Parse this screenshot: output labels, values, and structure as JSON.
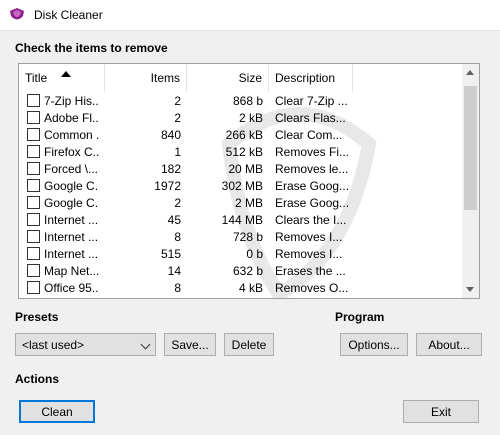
{
  "window": {
    "title": "Disk Cleaner"
  },
  "list_section": {
    "label": "Check the items to remove"
  },
  "columns": {
    "title": "Title",
    "items": "Items",
    "size": "Size",
    "description": "Description"
  },
  "rows": [
    {
      "title": "7-Zip His...",
      "items": "2",
      "size": "868 b",
      "description": "Clear 7-Zip ..."
    },
    {
      "title": "Adobe Fl...",
      "items": "2",
      "size": "2 kB",
      "description": "Clears Flas..."
    },
    {
      "title": "Common ...",
      "items": "840",
      "size": "266 kB",
      "description": "Clear Com..."
    },
    {
      "title": "Firefox C...",
      "items": "1",
      "size": "512 kB",
      "description": "Removes Fi..."
    },
    {
      "title": "Forced \\...",
      "items": "182",
      "size": "20 MB",
      "description": "Removes le..."
    },
    {
      "title": "Google C...",
      "items": "1972",
      "size": "302 MB",
      "description": "Erase Goog..."
    },
    {
      "title": "Google C...",
      "items": "2",
      "size": "2 MB",
      "description": "Erase Goog..."
    },
    {
      "title": "Internet ...",
      "items": "45",
      "size": "144 MB",
      "description": "Clears the I..."
    },
    {
      "title": "Internet ...",
      "items": "8",
      "size": "728 b",
      "description": "Removes I..."
    },
    {
      "title": "Internet ...",
      "items": "515",
      "size": "0 b",
      "description": "Removes I..."
    },
    {
      "title": "Map Net...",
      "items": "14",
      "size": "632 b",
      "description": "Erases the ..."
    },
    {
      "title": "Office 95...",
      "items": "8",
      "size": "4 kB",
      "description": "Removes O..."
    }
  ],
  "presets": {
    "label": "Presets",
    "selected": "<last used>",
    "save_label": "Save...",
    "delete_label": "Delete"
  },
  "program": {
    "label": "Program",
    "options_label": "Options...",
    "about_label": "About..."
  },
  "actions": {
    "label": "Actions",
    "clean_label": "Clean",
    "exit_label": "Exit"
  },
  "colors": {
    "accent": "#0078d7",
    "app_icon": "#8e1f8e"
  }
}
